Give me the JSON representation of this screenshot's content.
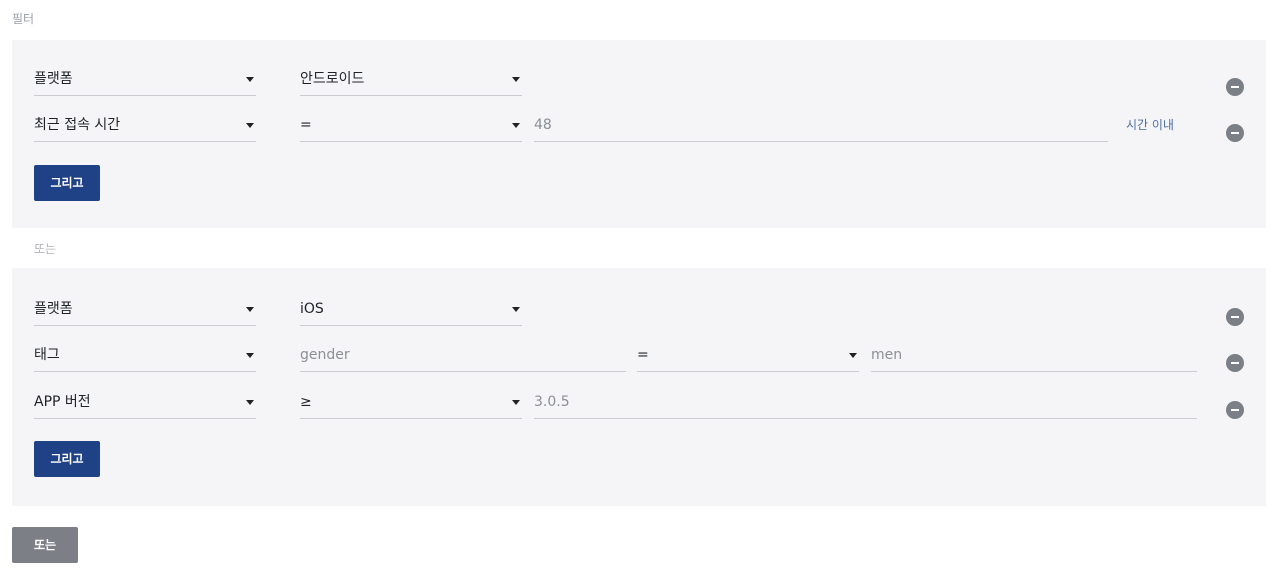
{
  "header": {
    "title": "필터"
  },
  "groups": [
    {
      "rows": [
        {
          "field": "플랫폼",
          "operator": "안드로이드"
        },
        {
          "field": "최근 접속 시간",
          "operator": "=",
          "value": "48",
          "unit": "시간 이내"
        }
      ],
      "and_label": "그리고"
    },
    {
      "rows": [
        {
          "field": "플랫폼",
          "operator": "iOS"
        },
        {
          "field": "태그",
          "key": "gender",
          "operator": "=",
          "value": "men"
        },
        {
          "field": "APP 버전",
          "operator": "≥",
          "value": "3.0.5"
        }
      ],
      "and_label": "그리고"
    }
  ],
  "separator_label": "또는",
  "or_button_label": "또는",
  "colors": {
    "primary": "#1f4185",
    "secondary": "#7c7f86",
    "panel": "#f5f5f7"
  }
}
